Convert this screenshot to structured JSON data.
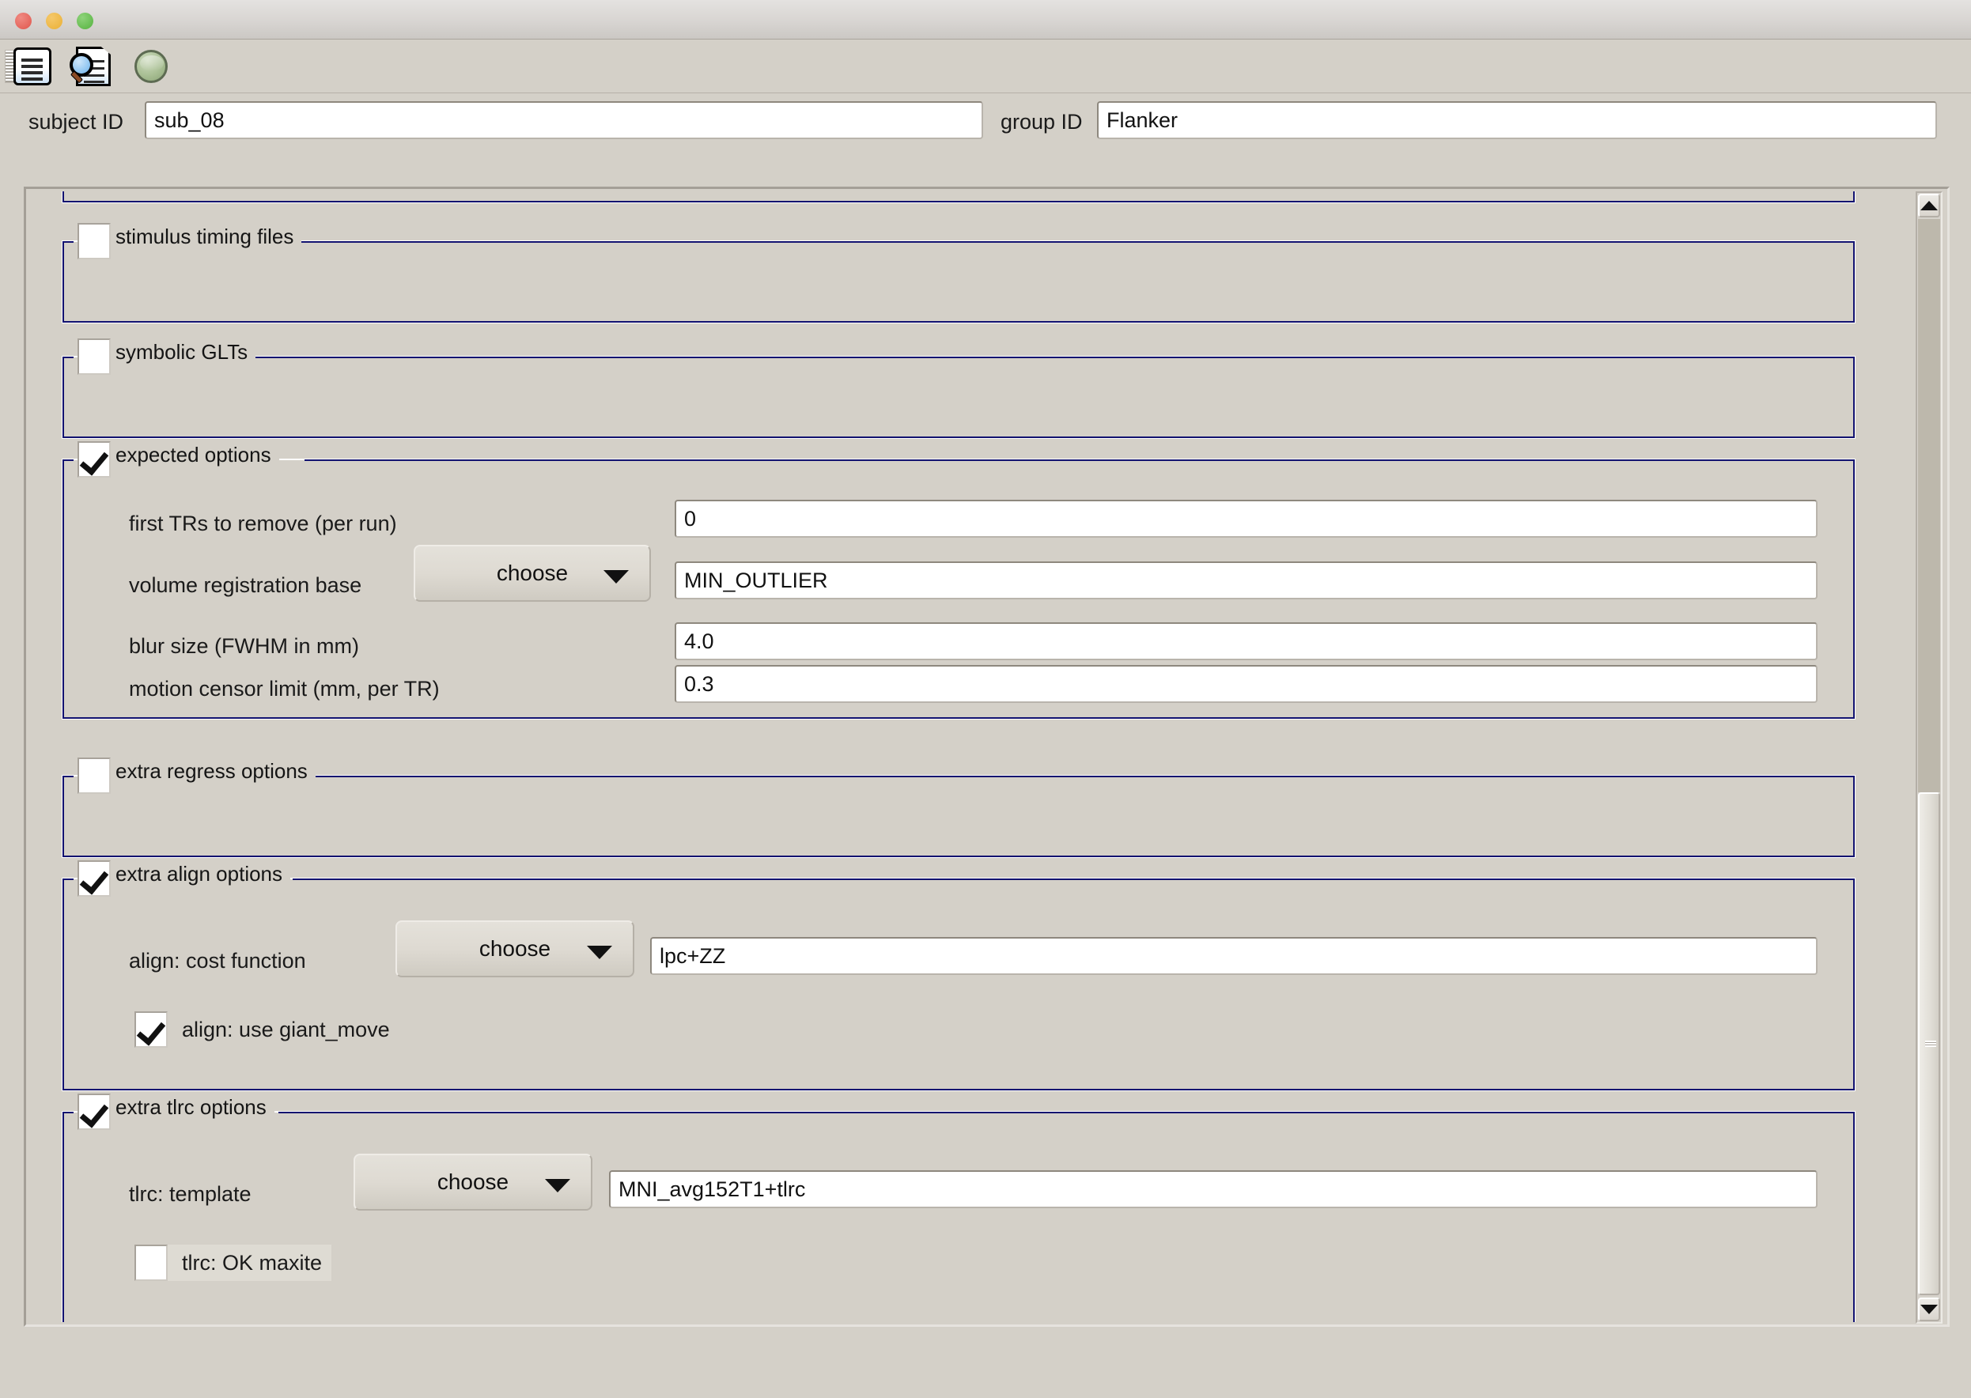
{
  "window": {
    "traffic_lights": [
      "close",
      "minimize",
      "maximize"
    ],
    "toolbar_icons": [
      "document-icon",
      "find-page-icon",
      "green-ball-icon"
    ]
  },
  "header": {
    "subject_label": "subject ID",
    "subject_value": "sub_08",
    "group_label": "group ID",
    "group_value": "Flanker"
  },
  "sections": {
    "stimulus_timing": {
      "title": "stimulus timing files",
      "checked": false
    },
    "symbolic_glts": {
      "title": "symbolic GLTs",
      "checked": false
    },
    "expected_options": {
      "title": "expected options",
      "checked": true,
      "rows": [
        {
          "label": "first TRs to remove (per run)",
          "value": "0"
        },
        {
          "label": "volume registration base",
          "button": "choose",
          "value": "MIN_OUTLIER"
        },
        {
          "label": "blur size (FWHM in mm)",
          "value": "4.0"
        },
        {
          "label": "motion censor limit (mm, per TR)",
          "value": "0.3"
        }
      ]
    },
    "extra_regress": {
      "title": "extra regress options",
      "checked": false
    },
    "extra_align": {
      "title": "extra align options",
      "checked": true,
      "cost_label": "align: cost function",
      "cost_button": "choose",
      "cost_value": "lpc+ZZ",
      "giant_move_label": "align: use giant_move",
      "giant_move_checked": true
    },
    "extra_tlrc": {
      "title": "extra tlrc options",
      "checked": true,
      "template_label": "tlrc: template",
      "template_button": "choose",
      "template_value": "MNI_avg152T1+tlrc",
      "maxite_label": "tlrc: OK maxite",
      "maxite_checked": false
    }
  },
  "scrollbar": {
    "up_arrow": "scroll-up",
    "down_arrow": "scroll-down"
  },
  "colors": {
    "background": "#d4d0c8",
    "frame_line": "#121270",
    "field_background": "#ffffff"
  }
}
